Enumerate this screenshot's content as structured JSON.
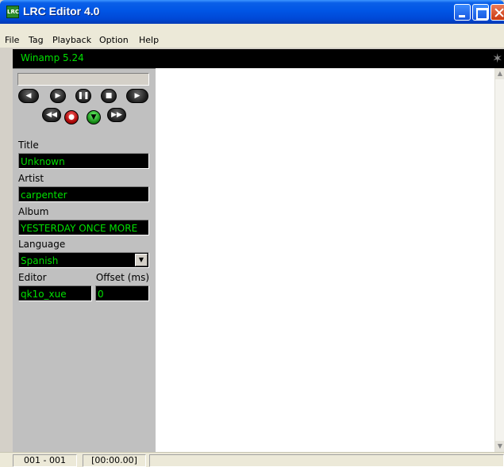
{
  "window": {
    "title": "LRC Editor 4.0",
    "icon_text": "LRC"
  },
  "menu": [
    "File",
    "Tag",
    "Playback",
    "Option",
    "Help"
  ],
  "player": {
    "name": "Winamp 5.24"
  },
  "controls": {
    "previous": "previous-icon",
    "play": "play-icon",
    "pause": "pause-icon",
    "stop": "stop-icon",
    "next": "next-icon",
    "rewind": "rewind-icon",
    "record": "record-icon",
    "tag": "tag-icon",
    "forward": "fast-forward-icon"
  },
  "tags": {
    "title_label": "Title",
    "title_value": "Unknown",
    "artist_label": "Artist",
    "artist_value": "carpenter",
    "album_label": "Album",
    "album_value": "YESTERDAY ONCE MORE",
    "language_label": "Language",
    "language_value": "Spanish",
    "editor_label": "Editor",
    "editor_value": "qk1o_xue",
    "offset_label": "Offset (ms)",
    "offset_value": "0"
  },
  "status": {
    "line": "001 - 001",
    "time": "[00:00.00]"
  },
  "colors": {
    "field_text": "#00e000",
    "field_bg": "#000000",
    "titlebar": "#0055e5"
  }
}
